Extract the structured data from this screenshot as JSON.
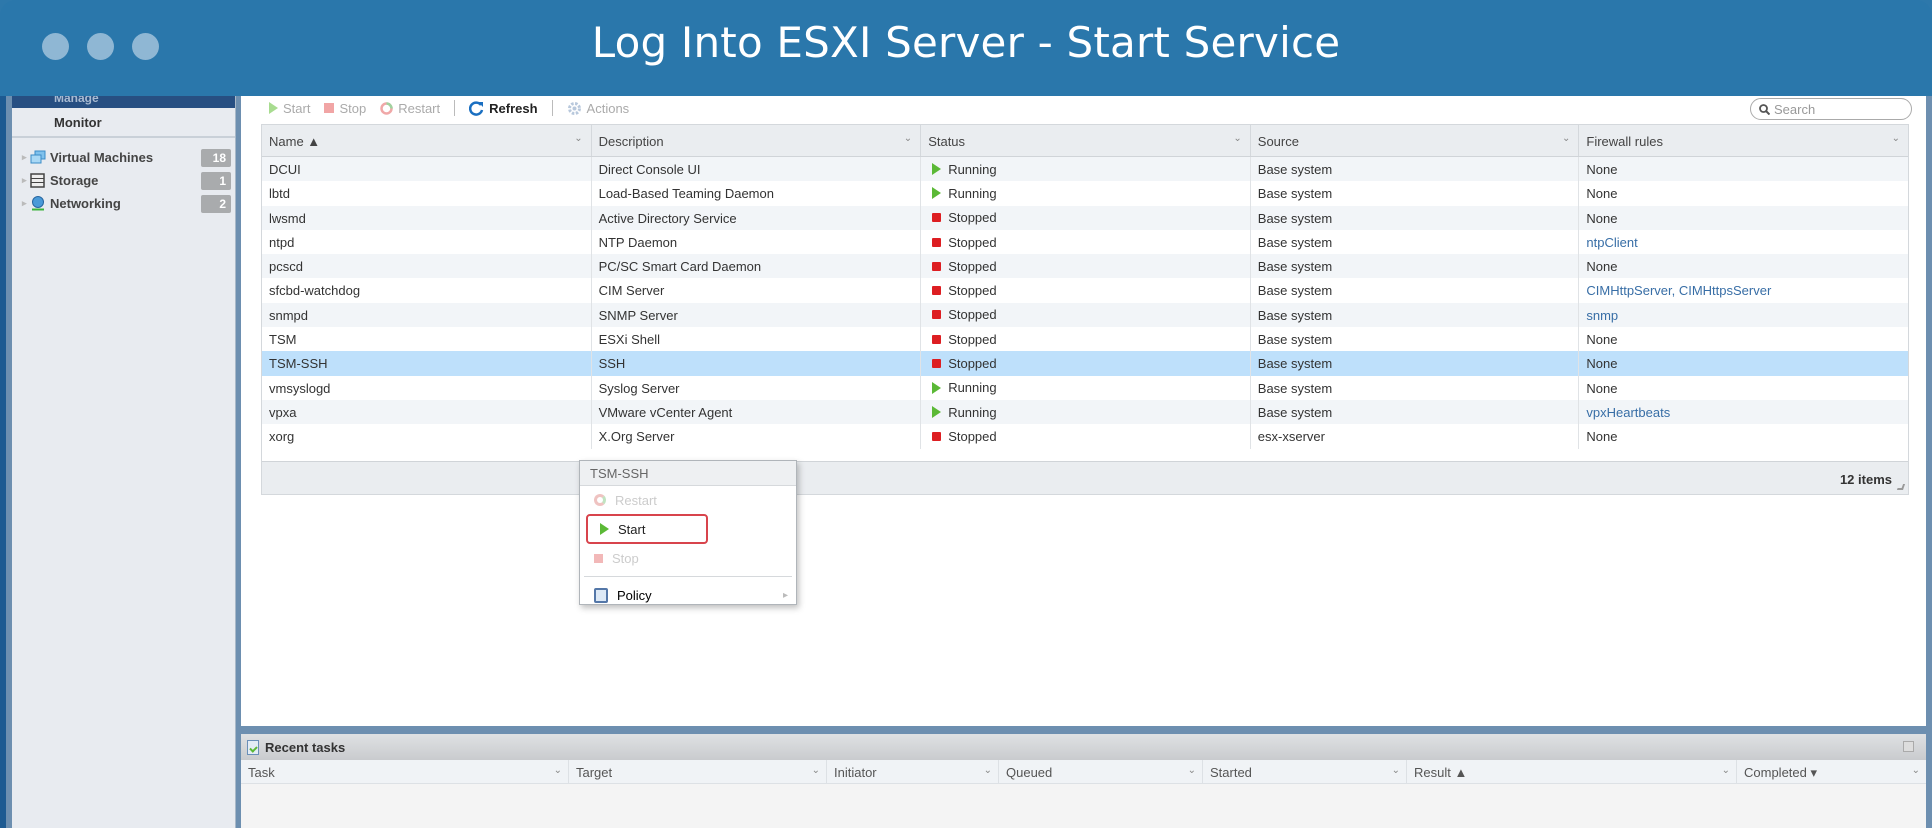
{
  "window": {
    "title": "Log Into ESXI Server - Start Service"
  },
  "sidebar": {
    "manage_label": "Manage",
    "monitor_label": "Monitor",
    "items": [
      {
        "label": "Virtual Machines",
        "count": "18",
        "icon": "virtual-machines-icon"
      },
      {
        "label": "Storage",
        "count": "1",
        "icon": "storage-icon"
      },
      {
        "label": "Networking",
        "count": "2",
        "icon": "networking-icon"
      }
    ]
  },
  "toolbar": {
    "start_label": "Start",
    "stop_label": "Stop",
    "restart_label": "Restart",
    "refresh_label": "Refresh",
    "actions_label": "Actions"
  },
  "search": {
    "placeholder": "Search"
  },
  "services_table": {
    "columns": [
      "Name ▲",
      "Description",
      "Status",
      "Source",
      "Firewall rules"
    ],
    "rows": [
      {
        "name": "DCUI",
        "description": "Direct Console UI",
        "status": "Running",
        "source": "Base system",
        "firewall": "None",
        "firewall_link": false
      },
      {
        "name": "lbtd",
        "description": "Load-Based Teaming Daemon",
        "status": "Running",
        "source": "Base system",
        "firewall": "None",
        "firewall_link": false
      },
      {
        "name": "lwsmd",
        "description": "Active Directory Service",
        "status": "Stopped",
        "source": "Base system",
        "firewall": "None",
        "firewall_link": false
      },
      {
        "name": "ntpd",
        "description": "NTP Daemon",
        "status": "Stopped",
        "source": "Base system",
        "firewall": "ntpClient",
        "firewall_link": true
      },
      {
        "name": "pcscd",
        "description": "PC/SC Smart Card Daemon",
        "status": "Stopped",
        "source": "Base system",
        "firewall": "None",
        "firewall_link": false
      },
      {
        "name": "sfcbd-watchdog",
        "description": "CIM Server",
        "status": "Stopped",
        "source": "Base system",
        "firewall": "CIMHttpServer, CIMHttpsServer",
        "firewall_link": true
      },
      {
        "name": "snmpd",
        "description": "SNMP Server",
        "status": "Stopped",
        "source": "Base system",
        "firewall": "snmp",
        "firewall_link": true
      },
      {
        "name": "TSM",
        "description": "ESXi Shell",
        "status": "Stopped",
        "source": "Base system",
        "firewall": "None",
        "firewall_link": false
      },
      {
        "name": "TSM-SSH",
        "description": "SSH",
        "status": "Stopped",
        "source": "Base system",
        "firewall": "None",
        "firewall_link": false,
        "selected": true
      },
      {
        "name": "vmsyslogd",
        "description": "Syslog Server",
        "status": "Running",
        "source": "Base system",
        "firewall": "None",
        "firewall_link": false
      },
      {
        "name": "vpxa",
        "description": "VMware vCenter Agent",
        "status": "Running",
        "source": "Base system",
        "firewall": "vpxHeartbeats",
        "firewall_link": true
      },
      {
        "name": "xorg",
        "description": "X.Org Server",
        "status": "Stopped",
        "source": "esx-xserver",
        "firewall": "None",
        "firewall_link": false
      }
    ],
    "footer_count": "12 items"
  },
  "context_menu": {
    "header": "TSM-SSH",
    "items": [
      {
        "label": "Restart",
        "enabled": false,
        "icon": "restart-icon"
      },
      {
        "label": "Start",
        "enabled": true,
        "highlighted": true,
        "icon": "start-icon"
      },
      {
        "label": "Stop",
        "enabled": false,
        "icon": "stop-icon"
      },
      {
        "label": "Policy",
        "enabled": true,
        "submenu": true,
        "icon": "policy-icon"
      }
    ]
  },
  "recent_tasks": {
    "title": "Recent tasks",
    "columns": [
      "Task",
      "Target",
      "Initiator",
      "Queued",
      "Started",
      "Result ▲",
      "Completed ▾"
    ]
  }
}
